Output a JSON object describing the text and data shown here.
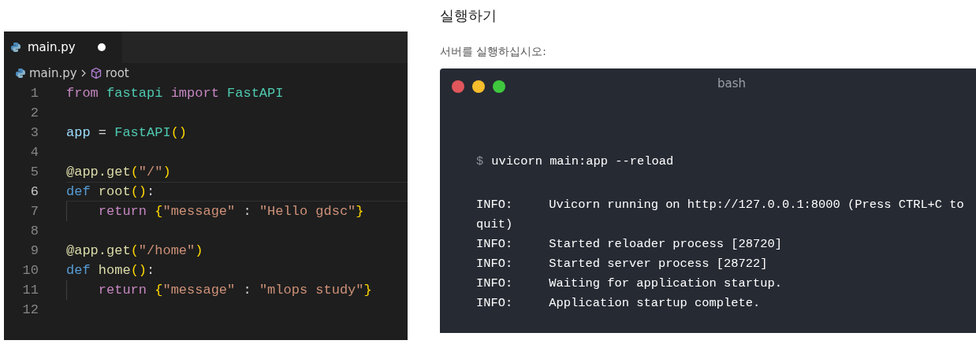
{
  "editor": {
    "tab": {
      "label": "main.py",
      "modified": true
    },
    "breadcrumb": [
      {
        "label": "main.py",
        "kind": "file"
      },
      {
        "label": "root",
        "kind": "symbol"
      }
    ],
    "lines": [
      {
        "number": "1",
        "current": false,
        "indent_guide": false,
        "tokens": [
          {
            "text": "from",
            "kind": "keyword"
          },
          {
            "text": " fastapi",
            "kind": "class"
          },
          {
            "text": " import",
            "kind": "keyword"
          },
          {
            "text": " FastAPI",
            "kind": "class"
          }
        ]
      },
      {
        "number": "2",
        "current": false,
        "indent_guide": false
      },
      {
        "number": "3",
        "current": false,
        "indent_guide": false,
        "tokens": [
          {
            "text": "app",
            "kind": "variable"
          },
          {
            "text": " = "
          },
          {
            "text": "FastAPI",
            "kind": "class"
          },
          {
            "text": "()",
            "kind": "bracket"
          }
        ]
      },
      {
        "number": "4",
        "current": false,
        "indent_guide": false
      },
      {
        "number": "5",
        "current": false,
        "indent_guide": false,
        "tokens": [
          {
            "text": "@app.get",
            "kind": "decorator"
          },
          {
            "text": "(",
            "kind": "bracket"
          },
          {
            "text": "\"/\"",
            "kind": "string"
          },
          {
            "text": ")",
            "kind": "bracket"
          }
        ]
      },
      {
        "number": "6",
        "current": true,
        "indent_guide": false,
        "tokens": [
          {
            "text": "def",
            "kind": "storage"
          },
          {
            "text": " root",
            "kind": "function"
          },
          {
            "text": "()",
            "kind": "bracket"
          },
          {
            "text": ":"
          }
        ]
      },
      {
        "number": "7",
        "current": false,
        "indent_guide": true,
        "tokens": [
          {
            "text": "    return",
            "kind": "keyword"
          },
          {
            "text": " {",
            "kind": "bracket"
          },
          {
            "text": "\"message\"",
            "kind": "string"
          },
          {
            "text": " : "
          },
          {
            "text": "\"Hello gdsc\"",
            "kind": "string"
          },
          {
            "text": "}",
            "kind": "bracket"
          }
        ]
      },
      {
        "number": "8",
        "current": false,
        "indent_guide": false
      },
      {
        "number": "9",
        "current": false,
        "indent_guide": false,
        "tokens": [
          {
            "text": "@app.get",
            "kind": "decorator"
          },
          {
            "text": "(",
            "kind": "bracket"
          },
          {
            "text": "\"/home\"",
            "kind": "string"
          },
          {
            "text": ")",
            "kind": "bracket"
          }
        ]
      },
      {
        "number": "10",
        "current": false,
        "indent_guide": false,
        "tokens": [
          {
            "text": "def",
            "kind": "storage"
          },
          {
            "text": " home",
            "kind": "function"
          },
          {
            "text": "()",
            "kind": "bracket"
          },
          {
            "text": ":"
          }
        ]
      },
      {
        "number": "11",
        "current": false,
        "indent_guide": true,
        "tokens": [
          {
            "text": "    return",
            "kind": "keyword"
          },
          {
            "text": " {",
            "kind": "bracket"
          },
          {
            "text": "\"message\"",
            "kind": "string"
          },
          {
            "text": " : "
          },
          {
            "text": "\"mlops study\"",
            "kind": "string"
          },
          {
            "text": "}",
            "kind": "bracket"
          }
        ]
      },
      {
        "number": "12",
        "current": false,
        "indent_guide": false
      }
    ]
  },
  "doc": {
    "heading": "실행하기",
    "text": "서버를 실행하십시오:",
    "terminal": {
      "title": "bash",
      "prompt": "$",
      "command": "uvicorn main:app --reload",
      "output": [
        "INFO:     Uvicorn running on http://127.0.0.1:8000 (Press CTRL+C to quit)",
        "INFO:     Started reloader process [28720]",
        "INFO:     Started server process [28722]",
        "INFO:     Waiting for application startup.",
        "INFO:     Application startup complete."
      ]
    }
  }
}
